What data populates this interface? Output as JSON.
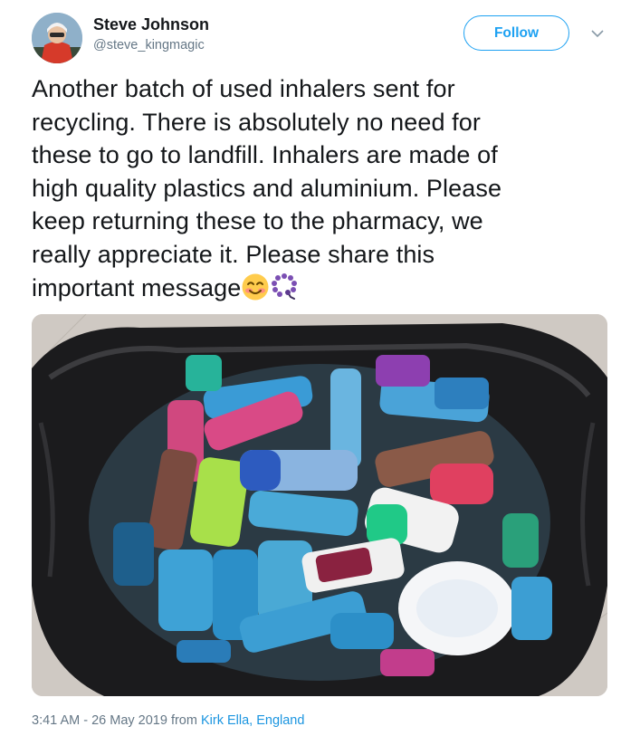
{
  "author": {
    "name": "Steve Johnson",
    "handle": "@steve_kingmagic"
  },
  "follow_label": "Follow",
  "tweet": {
    "text": "Another batch of used inhalers sent for\nrecycling. There is absolutely no need for\nthese to go to landfill. Inhalers are made of\nhigh quality plastics  and aluminium. Please\nkeep returning these to the pharmacy, we\nreally appreciate it. Please share this\nimportant message",
    "emojis": [
      "smiling-face-icon",
      "prayer-beads-icon"
    ]
  },
  "footer": {
    "timestamp": "3:41 AM - 26 May 2019 from",
    "location": "Kirk Ella, England"
  },
  "colors": {
    "accent": "#1da1f2",
    "secondary_text": "#657786",
    "text": "#14171a"
  }
}
